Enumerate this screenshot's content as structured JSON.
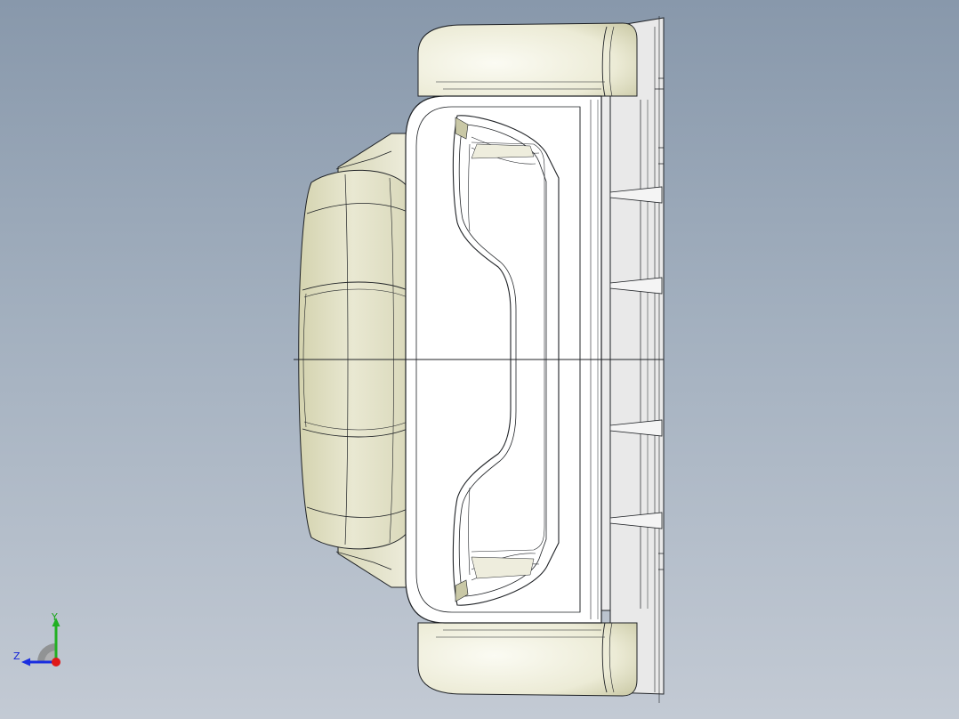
{
  "viewport": {
    "background_top": "#8898ab",
    "background_bottom": "#c3cad4"
  },
  "model": {
    "name": "3d-part-model",
    "shade_light": "#f2f2e4",
    "shade_dark": "#c4c39b",
    "edge_color": "#1f2226"
  },
  "triad": {
    "y_label": "Y",
    "z_label": "Z",
    "y_color": "#22b022",
    "z_color": "#1a2ee0",
    "x_color": "#e01818"
  }
}
